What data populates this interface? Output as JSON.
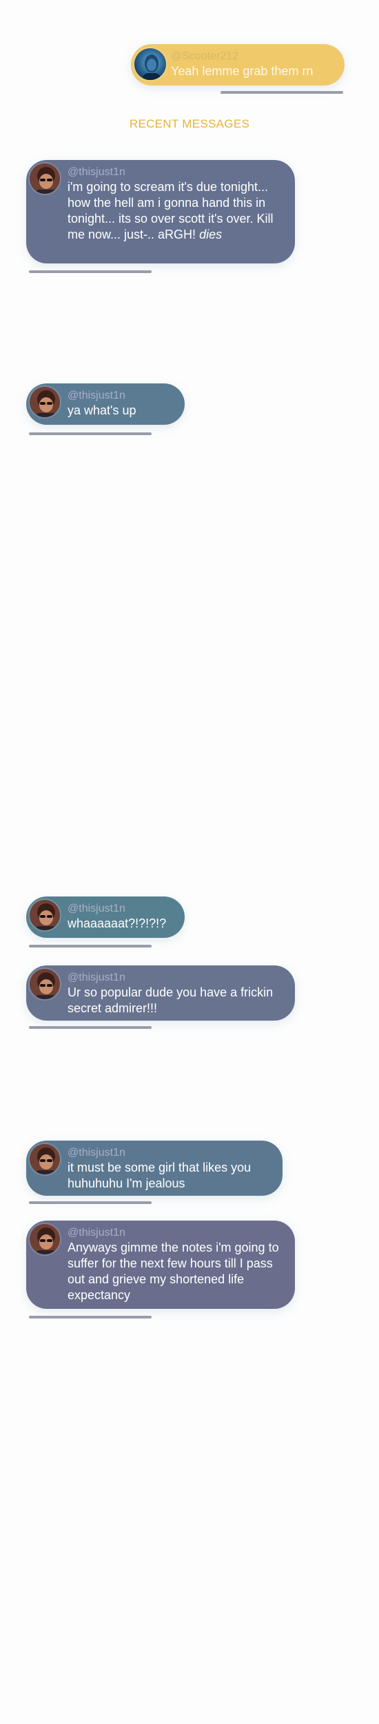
{
  "top_message": {
    "handle": "@Scooter212",
    "text": "Yeah lemme grab them rn",
    "avatar_icon": "scooter-avatar-icon",
    "bubble_color": "#efc96a"
  },
  "section_title": "RECENT MESSAGES",
  "messages": [
    {
      "handle": "@thisjust1n",
      "text_main": "i'm going to scream it's due tonight... how the hell am i gonna hand this in tonight... its so over scott it's over. Kill me now... just-.. aRGH! ",
      "text_emph": "dies",
      "bubble_color": "#65718f"
    },
    {
      "handle": "@thisjust1n",
      "text_main": "ya what's up",
      "bubble_color": "#5b7b93"
    },
    {
      "handle": "@thisjust1n",
      "text_main": "whaaaaaat?!?!?!?",
      "bubble_color": "#56808f"
    },
    {
      "handle": "@thisjust1n",
      "text_main": "Ur so popular dude you have a frickin secret admirer!!!",
      "bubble_color": "#68738f"
    },
    {
      "handle": "@thisjust1n",
      "text_main": "it must be some girl that likes you huhuhuhu I'm jealous",
      "bubble_color": "#5b7890"
    },
    {
      "handle": "@thisjust1n",
      "text_main": "Anyways gimme the notes i'm going to suffer for the next few hours till I pass out and grieve my shortened life expectancy",
      "bubble_color": "#6a6e8c"
    }
  ],
  "avatar_icon": "thisjust1n-avatar-icon"
}
